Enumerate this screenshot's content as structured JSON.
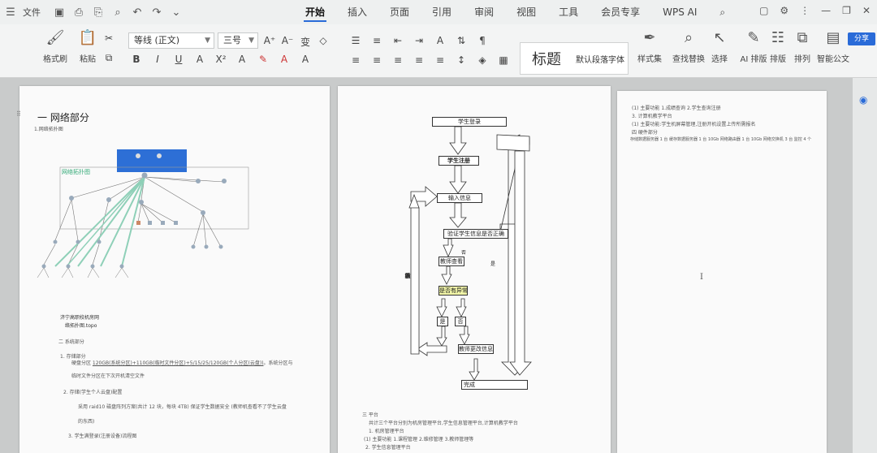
{
  "titlebar": {
    "file_menu": "文件",
    "tabs": [
      "开始",
      "插入",
      "页面",
      "引用",
      "审阅",
      "视图",
      "工具",
      "会员专享",
      "WPS AI"
    ],
    "active_tab": "开始"
  },
  "ribbon": {
    "format_painter": "格式刷",
    "paste": "粘贴",
    "font_name": "等线 (正文)",
    "font_size": "三号",
    "style_heading": "标题",
    "style_normal": "默认段落字体",
    "style_set": "样式集",
    "find_replace": "查找替换",
    "select": "选择",
    "ai_layout": "AI 排版",
    "layout": "排版",
    "sort": "排列",
    "smart_doc": "智能公文",
    "share": "分享"
  },
  "page1": {
    "heading": "一 网络部分",
    "sub1": "1.网络拓扑图",
    "caption1": "济宁高职校机房网",
    "caption2": "络拓扑图.topo",
    "sec2": "二  系统部分",
    "item1": "1.   存储部分",
    "line1_pre": "硬盘分区 ",
    "line1_ul": "120GB(系统分区)+110GB(临时文件分区)+5/15/25/120GB(个人分区(云盘))",
    "line1_post": "。系统分区与",
    "line2": "临时文件分区在下次开机清空文件",
    "item2": "2.   存储(学生个人云盘)配置",
    "line3": "采用 raid10 磁盘阵列方案(共计 12 块，每块 4TB) 保证学生数据安全 (教师机查看不了学生云盘",
    "line4": "的东西)",
    "item3": "3.   学生满登录(注册设备)流程图"
  },
  "flow": {
    "login": "学生登录",
    "register": "学生注册",
    "input": "输入信息",
    "verify": "验证学生信息是否正确",
    "no": "否",
    "yes": "是",
    "teacher_check": "教师查看",
    "has_error": "是否有异常",
    "yes2": "是",
    "no2": "否",
    "teacher_modify": "教师更改信息",
    "done": "完成",
    "side_text": [
      "学",
      "生",
      "重",
      "新",
      "输",
      "入"
    ],
    "sec3": "三  平台",
    "sec3_line1": "共计三个平台分别为机房管理平台,学生信息管理平台,计算机教学平台",
    "sec3_item1": "1.          机房管理平台",
    "sec3_item1a": "(1)          主要功能 1.课程管理 2.维修管理 3.教师管理等",
    "sec3_item2": "2.          学生信息管理平台"
  },
  "page3": {
    "l1": "(1)          主要功能 1.成绩查询 2.学生查询注册",
    "l2": "3.          计算机教学平台",
    "l3": "(1)          主要功能:学生机屏幕管理,注册开机设置上传所需报名",
    "l4": "四  硬件部分",
    "l5": "存储数据服务器 1 台 缓存数据服务器 1 台 10Gb 网络路由器 1 台 10Gb 网络交换机 3 台 监控 4 个"
  },
  "network": {
    "label": "网络拓扑图"
  }
}
